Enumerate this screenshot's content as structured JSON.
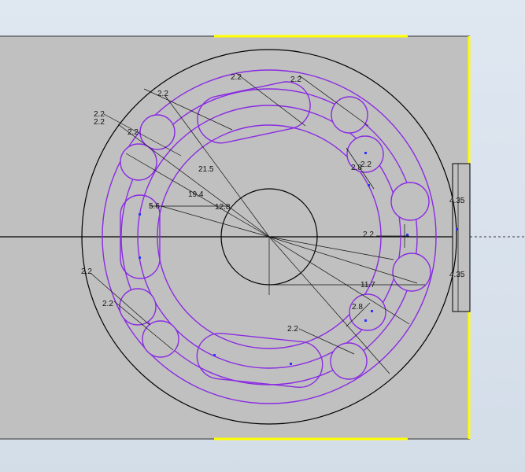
{
  "drawing": {
    "sheet_color": "#c0c0c0",
    "background_color": "#d6dfea",
    "geometry_color": "#8a2be2",
    "edge_color": "#000000",
    "highlight_color": "#ffff00",
    "dimension_color": "#111111",
    "point_color": "#3333ff"
  },
  "labels": {
    "d1": "2.2",
    "d2": "2.2",
    "d3": "2.2",
    "d4": "2.2",
    "d5": "2.2",
    "d6": "2.2",
    "d7": "2.2",
    "d8": "2.2",
    "d9": "2.2",
    "d10": "2.2",
    "d11": "2.8",
    "d12": "2.8",
    "d13": "21.5",
    "d14": "19.4",
    "d15": "5.6",
    "d16": "12.8",
    "d17": "11.7",
    "d18": "4.35",
    "d19": "4.35",
    "d20": "2.2"
  }
}
